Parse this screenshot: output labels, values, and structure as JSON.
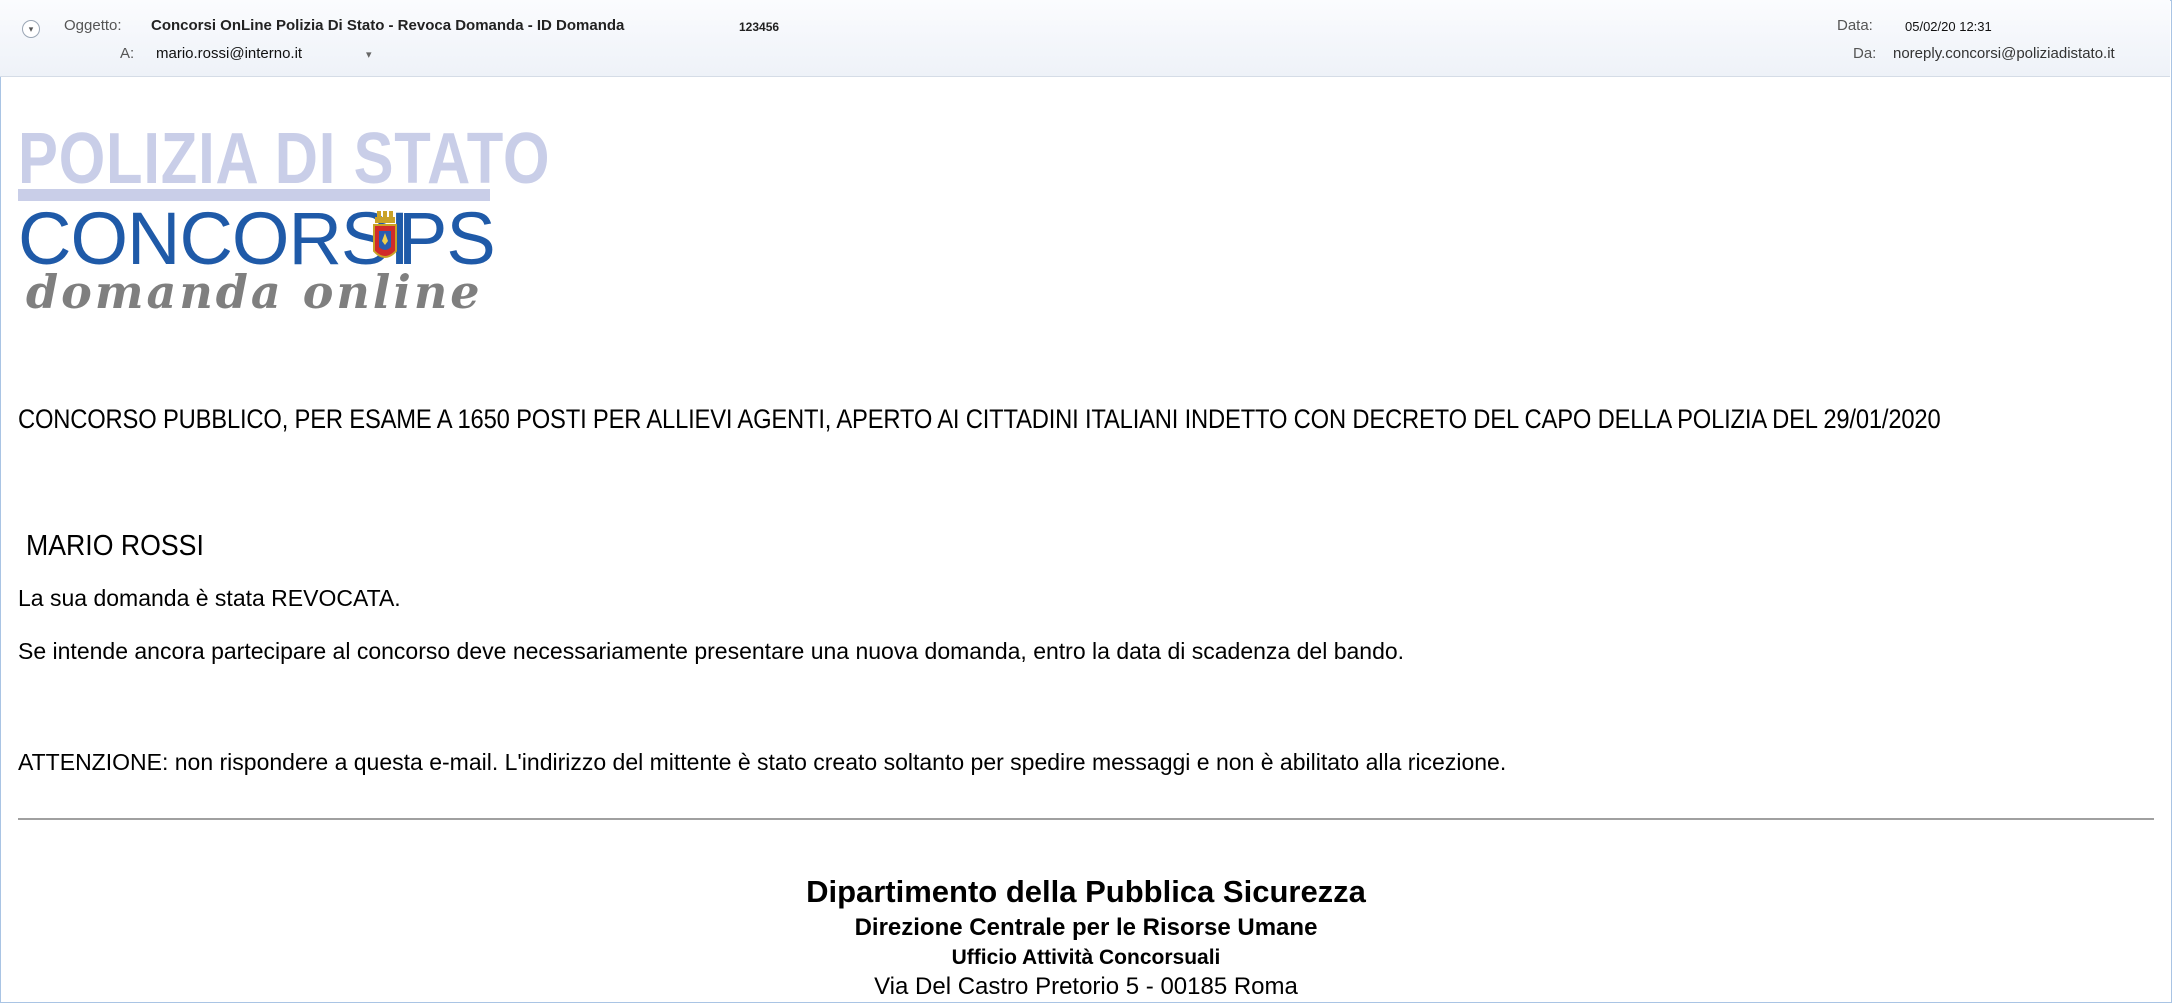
{
  "header": {
    "subject_label": "Oggetto:",
    "subject": "Concorsi OnLine Polizia Di Stato - Revoca Domanda - ID Domanda",
    "subject_id": "123456",
    "to_label": "A:",
    "to": "mario.rossi@interno.it",
    "date_label": "Data:",
    "date": "05/02/20 12:31",
    "from_label": "Da:",
    "from": "noreply.concorsi@poliziadistato.it"
  },
  "logo": {
    "top_text": "POLIZIA DI STATO",
    "main_text": "CONCORSI",
    "suffix_text": "PS",
    "tagline": "domanda online"
  },
  "body": {
    "concorso": "CONCORSO PUBBLICO, PER ESAME A 1650 POSTI PER ALLIEVI AGENTI, APERTO AI CITTADINI ITALIANI INDETTO CON DECRETO DEL CAPO DELLA POLIZIA DEL 29/01/2020",
    "name": "MARIO ROSSI",
    "line1": "La sua domanda è stata REVOCATA.",
    "line2": "Se intende ancora partecipare al concorso deve necessariamente presentare una nuova domanda, entro la data di scadenza del bando.",
    "line3": "ATTENZIONE: non rispondere a questa e-mail. L'indirizzo del mittente è stato creato soltanto per spedire messaggi e non è abilitato alla ricezione."
  },
  "footer": {
    "line1": "Dipartimento della Pubblica Sicurezza",
    "line2": "Direzione Centrale per le Risorse Umane",
    "line3": "Ufficio Attività Concorsuali",
    "line4": "Via Del Castro Pretorio 5 - 00185 Roma"
  },
  "colors": {
    "logo_blue": "#1f5aa8",
    "logo_light": "#c9cee8",
    "tagline_gray": "#7f7f7f",
    "header_bg": "#eef2f8"
  }
}
